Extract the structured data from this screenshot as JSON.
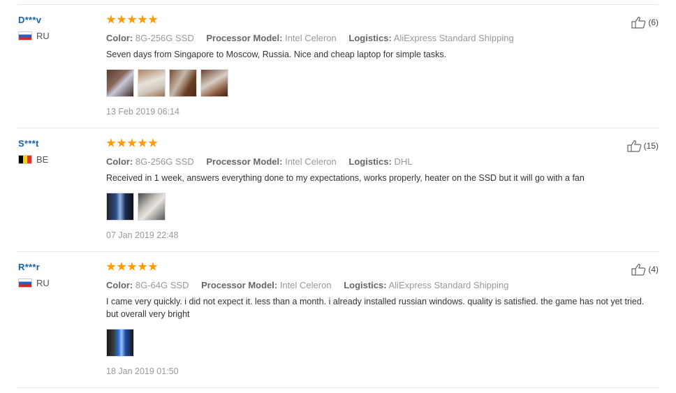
{
  "reviews": [
    {
      "user": "D***v",
      "country": "RU",
      "flag": "russia",
      "rating": 5,
      "attrs": [
        {
          "key": "Color:",
          "value": "8G-256G SSD"
        },
        {
          "key": "Processor Model:",
          "value": "Intel Celeron"
        },
        {
          "key": "Logistics:",
          "value": "AliExpress Standard Shipping"
        }
      ],
      "text": "Seven days from Singapore to Moscow, Russia. Nice and cheap laptop for simple tasks.",
      "photos": [
        "laptop-photo",
        "laptop-photo",
        "laptop-photo",
        "laptop-photo"
      ],
      "date": "13 Feb 2019 06:14",
      "helpful": "(6)"
    },
    {
      "user": "S***t",
      "country": "BE",
      "flag": "belgium",
      "rating": 5,
      "attrs": [
        {
          "key": "Color:",
          "value": "8G-256G SSD"
        },
        {
          "key": "Processor Model:",
          "value": "Intel Celeron"
        },
        {
          "key": "Logistics:",
          "value": "DHL"
        }
      ],
      "text": "Received in 1 week, answers everything done to my expectations, works properly, heater on the SSD but it will go with a fan",
      "photos": [
        "laptop-photo",
        "laptop-photo"
      ],
      "date": "07 Jan 2019 22:48",
      "helpful": "(15)"
    },
    {
      "user": "R***r",
      "country": "RU",
      "flag": "russia",
      "rating": 5,
      "attrs": [
        {
          "key": "Color:",
          "value": "8G-64G SSD"
        },
        {
          "key": "Processor Model:",
          "value": "Intel Celeron"
        },
        {
          "key": "Logistics:",
          "value": "AliExpress Standard Shipping"
        }
      ],
      "text": "I came very quickly. i did not expect it. less than a month. i already installed russian windows. quality is satisfied. the game has not yet tried. but overall very bright",
      "photos": [
        "laptop-photo"
      ],
      "date": "18 Jan 2019 01:50",
      "helpful": "(4)"
    }
  ],
  "colors": {
    "star": "#ff9a00",
    "username": "#1a60a8"
  }
}
